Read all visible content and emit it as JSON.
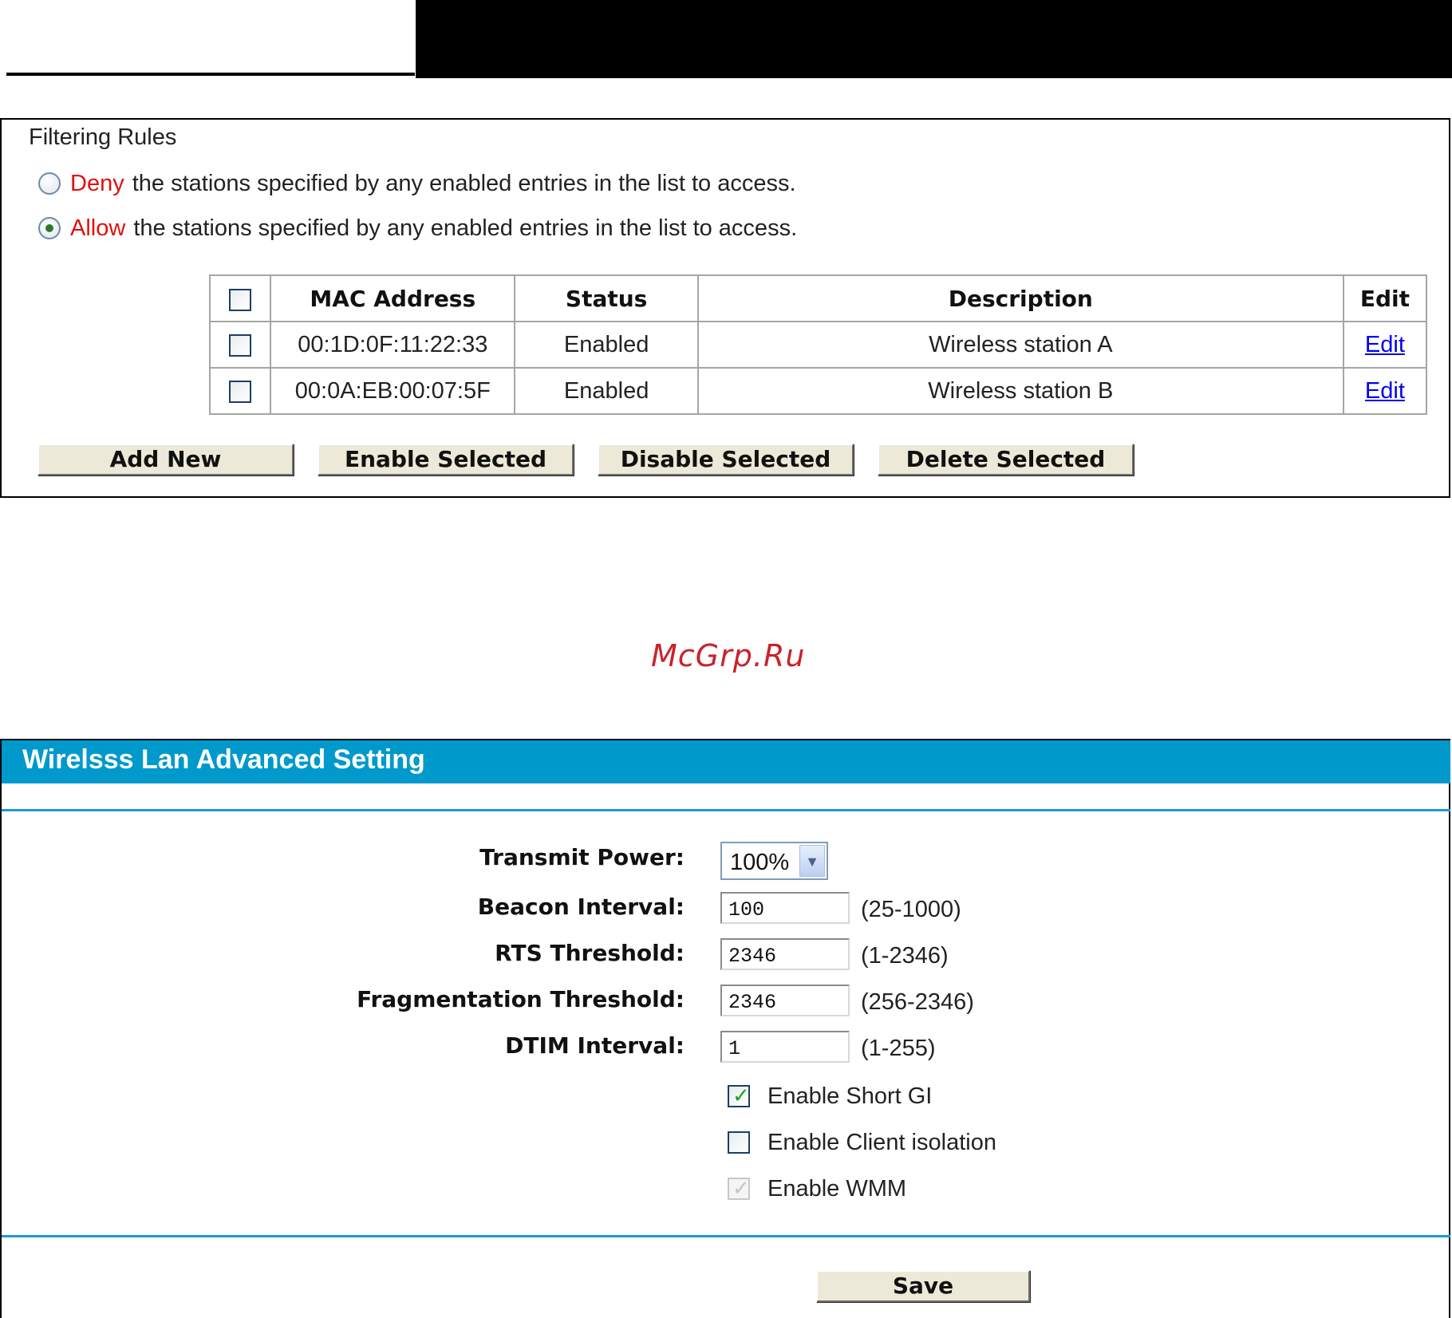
{
  "filtering": {
    "title": "Filtering Rules",
    "deny": {
      "keyword": "Deny",
      "text": "the stations specified by any enabled entries in the list to access.",
      "selected": false
    },
    "allow": {
      "keyword": "Allow",
      "text": "the stations specified by any enabled entries in the list to access.",
      "selected": true
    },
    "table": {
      "headers": {
        "mac": "MAC Address",
        "status": "Status",
        "description": "Description",
        "edit": "Edit"
      },
      "rows": [
        {
          "mac": "00:1D:0F:11:22:33",
          "status": "Enabled",
          "description": "Wireless station A",
          "edit": "Edit"
        },
        {
          "mac": "00:0A:EB:00:07:5F",
          "status": "Enabled",
          "description": "Wireless station B",
          "edit": "Edit"
        }
      ]
    },
    "buttons": {
      "add_new": "Add New",
      "enable_selected": "Enable Selected",
      "disable_selected": "Disable Selected",
      "delete_selected": "Delete Selected"
    }
  },
  "watermark": "McGrp.Ru",
  "advanced": {
    "title": "Wirelsss Lan Advanced Setting",
    "transmit_power": {
      "label": "Transmit Power:",
      "value": "100%"
    },
    "beacon_interval": {
      "label": "Beacon Interval:",
      "value": "100",
      "range": "(25-1000)"
    },
    "rts_threshold": {
      "label": "RTS Threshold:",
      "value": "2346",
      "range": "(1-2346)"
    },
    "fragmentation_threshold": {
      "label": "Fragmentation Threshold:",
      "value": "2346",
      "range": "(256-2346)"
    },
    "dtim_interval": {
      "label": "DTIM Interval:",
      "value": "1",
      "range": "(1-255)"
    },
    "options": {
      "short_gi": {
        "label": "Enable Short GI",
        "checked": true
      },
      "client_isolation": {
        "label": "Enable Client isolation",
        "checked": false
      },
      "wmm": {
        "label": "Enable WMM",
        "checked": true,
        "disabled": true
      }
    },
    "save_label": "Save"
  },
  "colors": {
    "header_bar": "#0099cc",
    "rule_keyword": "#e01010",
    "link": "#0000ee",
    "watermark": "#c8242b"
  }
}
